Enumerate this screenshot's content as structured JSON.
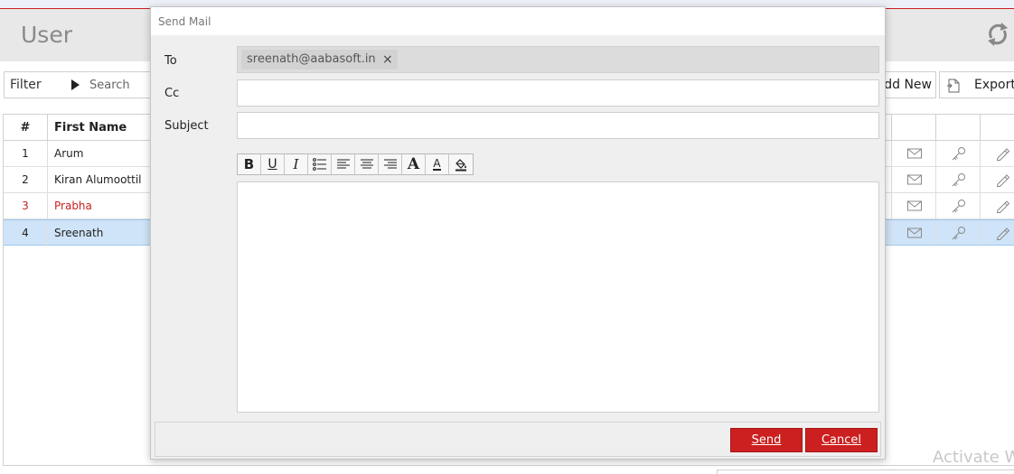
{
  "page": {
    "title": "User"
  },
  "toolbar": {
    "filter_label": "Filter",
    "search_placeholder": "Search",
    "add_label": "dd New",
    "export_label": "Export"
  },
  "grid": {
    "headers": {
      "number": "#",
      "first_name": "First Name"
    },
    "rows": [
      {
        "num": "1",
        "first_name": "Arum",
        "highlight": false,
        "selected": false
      },
      {
        "num": "2",
        "first_name": "Kiran Alumoottil",
        "highlight": false,
        "selected": false
      },
      {
        "num": "3",
        "first_name": "Prabha",
        "highlight": true,
        "selected": false
      },
      {
        "num": "4",
        "first_name": "Sreenath",
        "highlight": false,
        "selected": true
      }
    ]
  },
  "modal": {
    "title": "Send Mail",
    "to_label": "To",
    "cc_label": "Cc",
    "subject_label": "Subject",
    "to_recipient": "sreenath@aabasoft.in",
    "chip_close": "×",
    "cc_value": "",
    "subject_value": "",
    "editor_tools": {
      "bold": "B",
      "underline": "U",
      "italic": "I",
      "font": "A",
      "font_color": "A"
    },
    "send_label": "Send",
    "cancel_label": "Cancel"
  },
  "watermark": {
    "text": "Activate W"
  },
  "colors": {
    "accent_red": "#cc1f1f",
    "selected_row": "#cfe4f8",
    "highlight_text": "#c81e1e"
  }
}
